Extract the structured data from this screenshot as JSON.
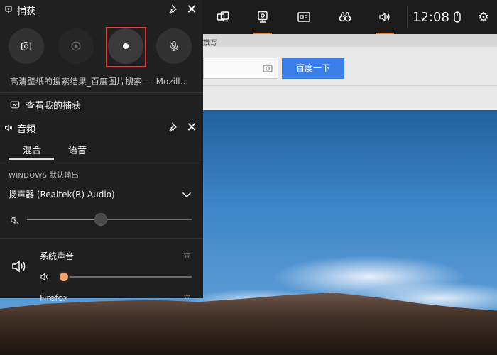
{
  "capture": {
    "title": "捕获",
    "current_app": "高清壁纸的搜索结果_百度图片搜索 — Mozill...",
    "see_captures": "查看我的捕获"
  },
  "audio": {
    "title": "音频",
    "tabs": [
      "混合",
      "语音"
    ],
    "windows_output_label": "WINDOWS 默认输出",
    "device": "扬声器 (Realtek(R) Audio)",
    "device_volume": 0.45,
    "system_sound_label": "系统声音",
    "system_sound_volume": 0.0,
    "next_app_label": "Firefox"
  },
  "topbar": {
    "clock": "12:08"
  },
  "browser": {
    "search_button": "百度一下",
    "top_strip_text": "撰写"
  },
  "colors": {
    "accent": "#f47b20",
    "highlight_border": "#e53935",
    "search_button_blue": "#3b7de9"
  },
  "icons": {
    "capture_header": "capture-icon",
    "screenshot": "camera-icon",
    "record_last": "record-last-icon",
    "record": "record-icon",
    "mic_mute": "mic-off-icon",
    "pin": "pin-icon",
    "close": "close-icon",
    "see_captures": "gallery-icon",
    "audio_header": "speaker-icon",
    "dropdown": "chevron-down-icon",
    "muted": "speaker-muted-icon",
    "star": "star-icon",
    "topbar": [
      "widget-menu-icon",
      "capture-icon",
      "performance-icon",
      "looking-for-group-icon",
      "audio-icon",
      "mouse-icon",
      "settings-icon"
    ]
  }
}
